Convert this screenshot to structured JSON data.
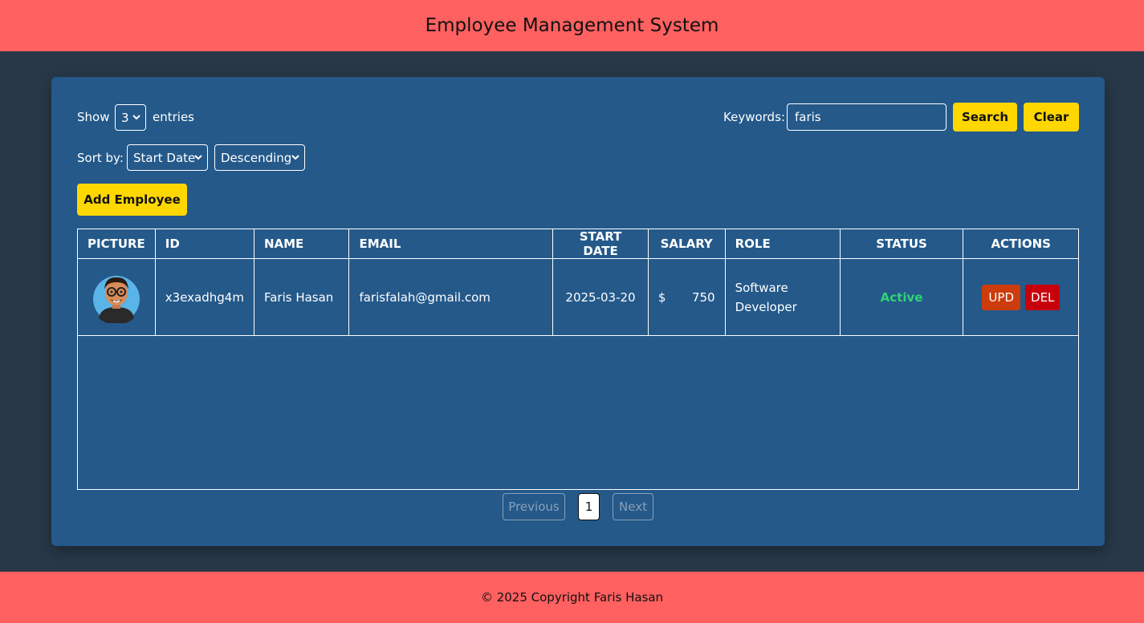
{
  "header": {
    "title": "Employee Management System"
  },
  "controls": {
    "show_label": "Show",
    "entries_value": "3",
    "entries_label": "entries",
    "keywords_label": "Keywords:",
    "keywords_value": "faris",
    "search_label": "Search",
    "clear_label": "Clear",
    "sort_label": "Sort by:",
    "sort_field": "Start Date",
    "sort_order": "Descending",
    "add_label": "Add Employee"
  },
  "table": {
    "columns": [
      "PICTURE",
      "ID",
      "NAME",
      "EMAIL",
      "START DATE",
      "SALARY",
      "ROLE",
      "STATUS",
      "ACTIONS"
    ],
    "rows": [
      {
        "id": "x3exadhg4m",
        "name": "Faris Hasan",
        "email": "farisfalah@gmail.com",
        "start_date": "2025-03-20",
        "salary_currency": "$",
        "salary_amount": "750",
        "role": "Software Developer",
        "status": "Active",
        "upd_label": "UPD",
        "del_label": "DEL"
      }
    ]
  },
  "pagination": {
    "previous": "Previous",
    "current": "1",
    "next": "Next"
  },
  "footer": {
    "text": "© 2025 Copyright Faris Hasan"
  },
  "colors": {
    "header_bg": "#ff6060",
    "page_bg": "#283848",
    "panel_bg": "#24598a",
    "accent": "#ffd700",
    "status_active": "#2ed573",
    "upd": "#cc3c0c",
    "del": "#c8000c"
  }
}
